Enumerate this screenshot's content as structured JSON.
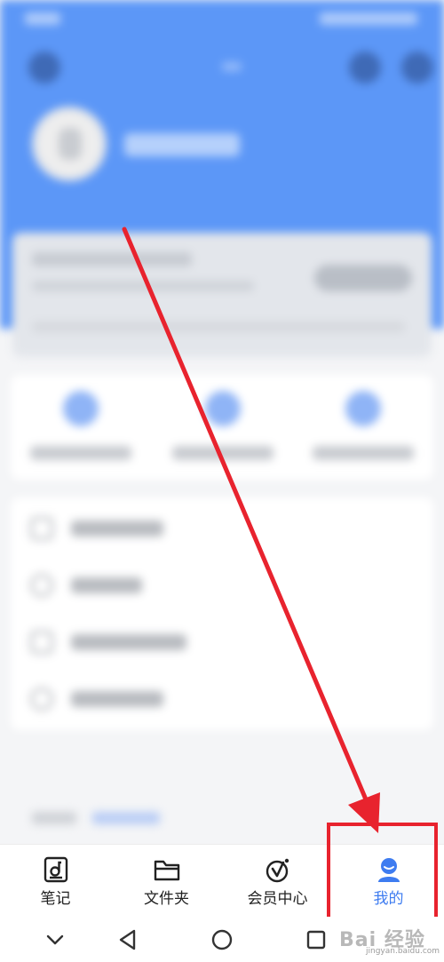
{
  "tabs": [
    {
      "label": "笔记",
      "icon": "note-icon"
    },
    {
      "label": "文件夹",
      "icon": "folder-icon"
    },
    {
      "label": "会员中心",
      "icon": "vip-center-icon"
    },
    {
      "label": "我的",
      "icon": "profile-icon",
      "active": true
    }
  ],
  "system_nav": [
    {
      "icon": "chevron-down-icon"
    },
    {
      "icon": "back-triangle-icon"
    },
    {
      "icon": "home-circle-icon"
    },
    {
      "icon": "recents-square-icon"
    }
  ],
  "watermark": {
    "text": "Bai 经验",
    "url": "jingyan.baidu.com"
  },
  "colors": {
    "header": "#5c97f7",
    "active_tab": "#3e7cf0",
    "annotation_red": "#e8232e"
  }
}
